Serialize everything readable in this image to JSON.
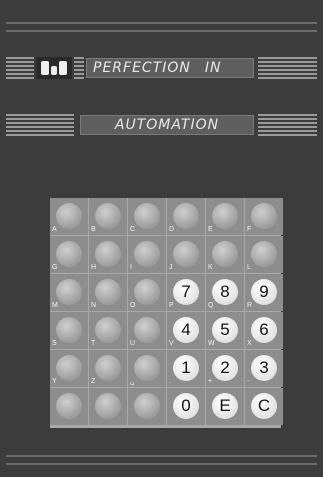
{
  "header": {
    "line1": "PERFECTION",
    "line1_dim": "",
    "line1_end": "IN",
    "line2": "AUTOMATION",
    "line2_dim_left": "",
    "line2_dim_right": ""
  },
  "keypad": {
    "rows": [
      [
        {
          "letter": "A"
        },
        {
          "letter": "B"
        },
        {
          "letter": "C"
        },
        {
          "letter": "D"
        },
        {
          "letter": "E"
        },
        {
          "letter": "F"
        }
      ],
      [
        {
          "letter": "G"
        },
        {
          "letter": "H"
        },
        {
          "letter": "I"
        },
        {
          "letter": "J"
        },
        {
          "letter": "K"
        },
        {
          "letter": "L"
        }
      ],
      [
        {
          "letter": "M"
        },
        {
          "letter": "N"
        },
        {
          "letter": "O"
        },
        {
          "letter": "P",
          "label": "7"
        },
        {
          "letter": "Q",
          "label": "8"
        },
        {
          "letter": "R",
          "label": "9"
        }
      ],
      [
        {
          "letter": "S"
        },
        {
          "letter": "T"
        },
        {
          "letter": "U"
        },
        {
          "letter": "V",
          "label": "4"
        },
        {
          "letter": "W",
          "label": "5"
        },
        {
          "letter": "X",
          "label": "6"
        }
      ],
      [
        {
          "letter": "Y"
        },
        {
          "letter": "Z"
        },
        {
          "letter": "␣"
        },
        {
          "letter": ".",
          "label": "1"
        },
        {
          "letter": "+",
          "label": "2"
        },
        {
          "letter": "-",
          "label": "3"
        }
      ],
      [
        {
          "letter": ""
        },
        {
          "letter": ""
        },
        {
          "letter": ""
        },
        {
          "letter": "",
          "label": "0"
        },
        {
          "letter": "",
          "label": "E"
        },
        {
          "letter": "",
          "label": "C"
        }
      ]
    ]
  },
  "colors": {
    "panel": "#3c3c3c",
    "key_lit": "#ffffff",
    "key_dim": "#9c9c9c",
    "text": "#e8e8e8"
  }
}
